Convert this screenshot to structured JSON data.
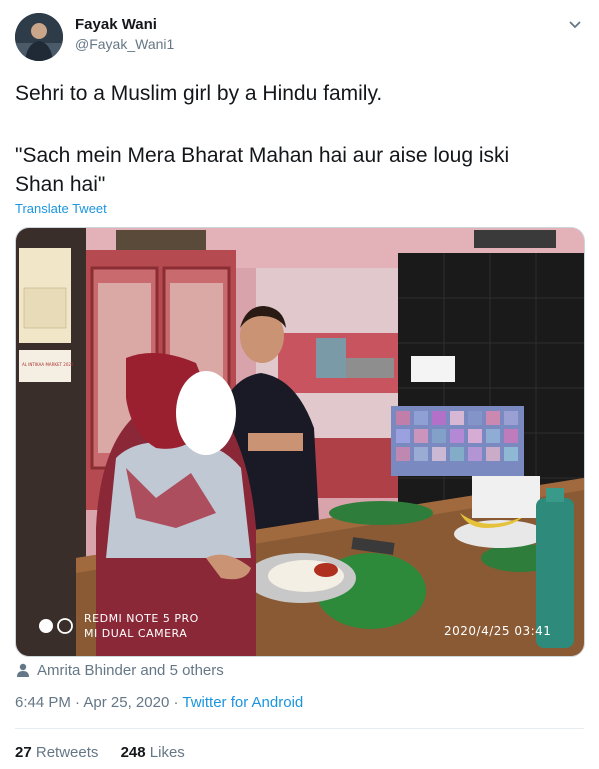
{
  "author": {
    "name": "Fayak Wani",
    "handle": "@Fayak_Wani1"
  },
  "tweet": {
    "line1": "Sehri to a Muslim girl by a Hindu family.",
    "line2a": "\"Sach mein Mera Bharat Mahan hai aur aise loug iski",
    "line2b": "Shan hai\"",
    "translate_label": "Translate Tweet"
  },
  "media": {
    "camera_line1": "REDMI NOTE 5 PRO",
    "camera_line2": "MI DUAL CAMERA",
    "timestamp": "2020/4/25  03:41",
    "calendar_label": "AL INTIKAA MARKET 2020"
  },
  "liked_by": "Amrita Bhinder and 5 others",
  "meta": {
    "time": "6:44 PM",
    "separator1": " · ",
    "date": "Apr 25, 2020",
    "separator2": " · ",
    "source": "Twitter for Android"
  },
  "stats": {
    "retweets_count": "27",
    "retweets_label": "Retweets",
    "likes_count": "248",
    "likes_label": "Likes"
  },
  "colors": {
    "link": "#1b95e0",
    "secondary_text": "#657786",
    "divider": "#e6ecf0"
  }
}
